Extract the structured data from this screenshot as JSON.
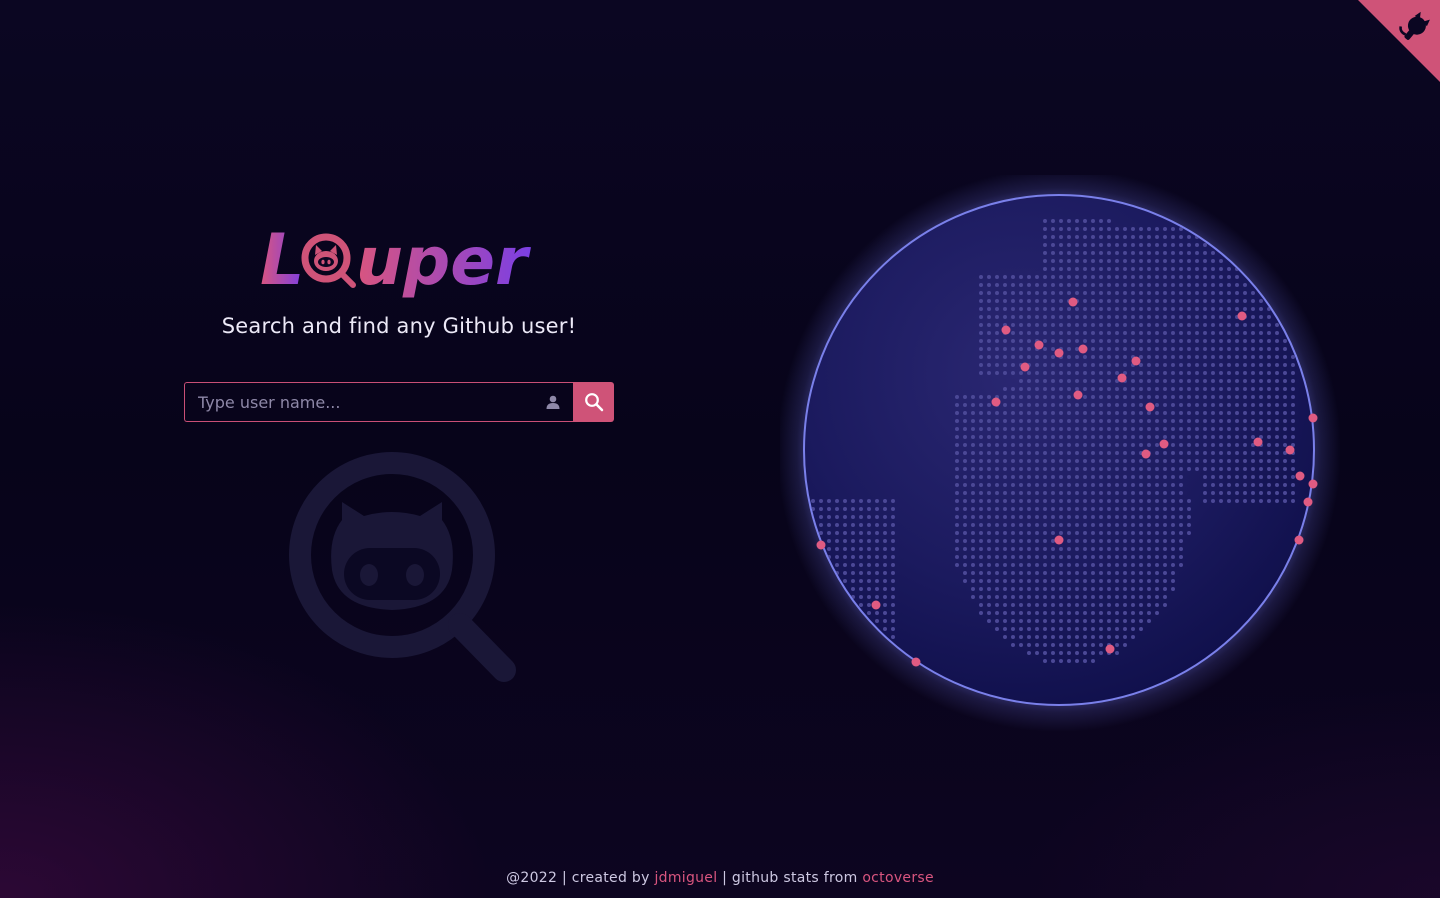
{
  "app": {
    "logo_text": "Looper",
    "tagline": "Search and find any Github user!"
  },
  "search": {
    "placeholder": "Type user name...",
    "value": ""
  },
  "footer": {
    "prefix": "@2022 | created by ",
    "author": "jdmiguel",
    "middle": " | github stats from ",
    "source": "octoverse"
  },
  "colors": {
    "accent": "#cf5378",
    "logo_gradient_start": "#d9557f",
    "logo_gradient_end": "#7b3fe4",
    "globe_fill": "#1a1a5e",
    "marker": "#e05b82"
  },
  "icons": {
    "corner": "github-octocat-icon",
    "user": "user-icon",
    "search": "search-icon",
    "watermark": "octocat-magnifier-icon"
  }
}
